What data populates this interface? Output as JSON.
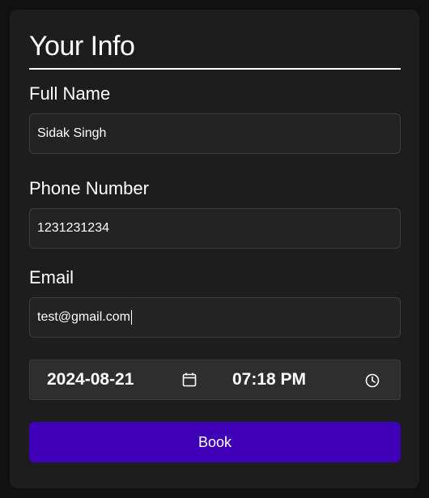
{
  "form": {
    "title": "Your Info",
    "full_name": {
      "label": "Full Name",
      "value": "Sidak Singh"
    },
    "phone": {
      "label": "Phone Number",
      "value": "1231231234"
    },
    "email": {
      "label": "Email",
      "value": "test@gmail.com"
    },
    "date": {
      "value": "2024-08-21",
      "icon": "calendar-icon"
    },
    "time": {
      "value": "07:18 PM",
      "icon": "clock-icon"
    },
    "book_label": "Book"
  },
  "colors": {
    "page_background": "#111111",
    "card_background": "#1d1d1d",
    "field_background": "#232323",
    "datetime_background": "#2e2e2e",
    "accent": "#3d00b6",
    "text": "#ffffff"
  }
}
